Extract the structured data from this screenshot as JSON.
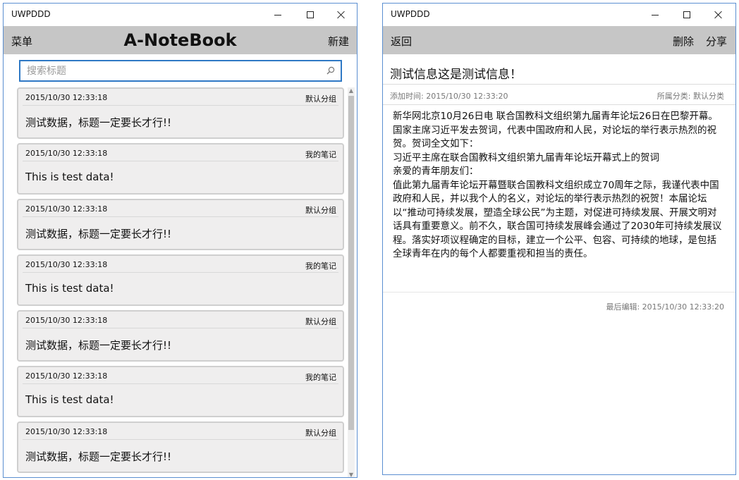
{
  "left_window": {
    "title": "UWPDDD",
    "appbar": {
      "menu_label": "菜单",
      "heading": "A-NoteBook",
      "new_label": "新建"
    },
    "search": {
      "placeholder": "搜索标题"
    },
    "notes": [
      {
        "time": "2015/10/30 12:33:18",
        "category": "默认分组",
        "title": "测试数据，标题一定要长才行!!"
      },
      {
        "time": "2015/10/30 12:33:18",
        "category": "我的笔记",
        "title": "This is test data!"
      },
      {
        "time": "2015/10/30 12:33:18",
        "category": "默认分组",
        "title": "测试数据，标题一定要长才行!!"
      },
      {
        "time": "2015/10/30 12:33:18",
        "category": "我的笔记",
        "title": "This is test data!"
      },
      {
        "time": "2015/10/30 12:33:18",
        "category": "默认分组",
        "title": "测试数据，标题一定要长才行!!"
      },
      {
        "time": "2015/10/30 12:33:18",
        "category": "我的笔记",
        "title": "This is test data!"
      },
      {
        "time": "2015/10/30 12:33:18",
        "category": "默认分组",
        "title": "测试数据，标题一定要长才行!!"
      }
    ]
  },
  "right_window": {
    "title": "UWPDDD",
    "appbar": {
      "back_label": "返回",
      "delete_label": "删除",
      "share_label": "分享"
    },
    "note": {
      "title": "测试信息这是测试信息！",
      "added": "添加时间: 2015/10/30 12:33:20",
      "category": "所属分类: 默认分类",
      "body": [
        "新华网北京10月26日电 联合国教科文组织第九届青年论坛26日在巴黎开幕。国家主席习近平发去贺词，代表中国政府和人民，对论坛的举行表示热烈的祝贺。贺词全文如下：",
        "习近平主席在联合国教科文组织第九届青年论坛开幕式上的贺词",
        "亲爱的青年朋友们：",
        "值此第九届青年论坛开幕暨联合国教科文组织成立70周年之际，我谨代表中国政府和人民，并以我个人的名义，对论坛的举行表示热烈的祝贺！本届论坛以“推动可持续发展，塑造全球公民”为主题，对促进可持续发展、开展文明对话具有重要意义。前不久，联合国可持续发展峰会通过了2030年可持续发展议程。落实好项议程确定的目标，建立一个公平、包容、可持续的地球，是包括全球青年在内的每个人都要重视和担当的责任。"
      ],
      "edited": "最后编辑: 2015/10/30 12:33:20"
    }
  }
}
